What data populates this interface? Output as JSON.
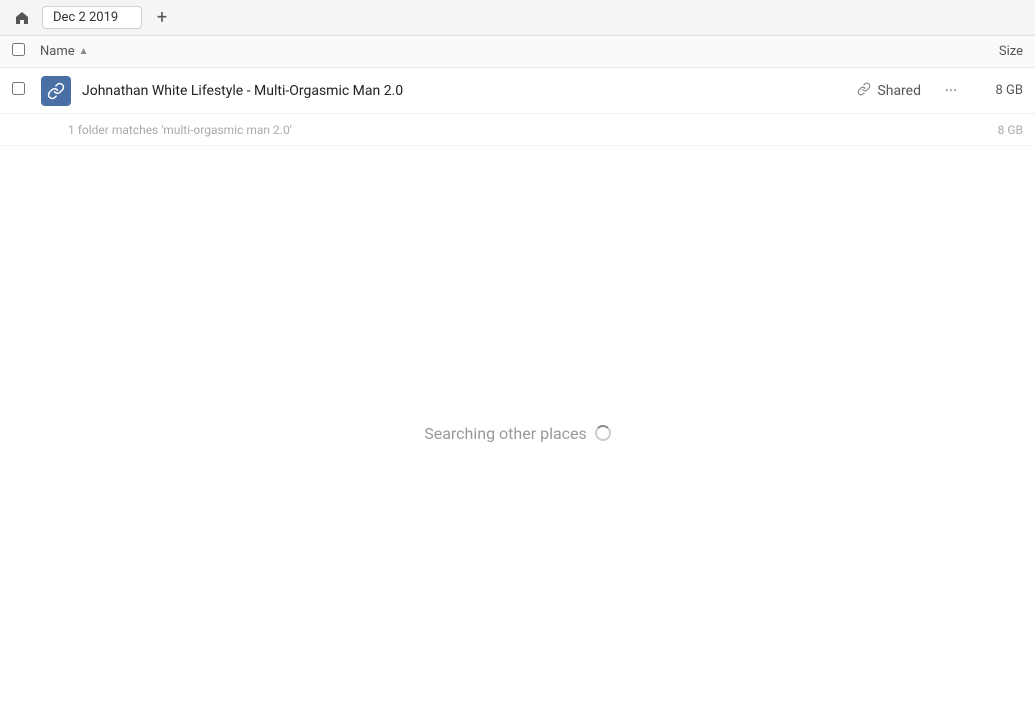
{
  "toolbar": {
    "home_icon": "🏠",
    "breadcrumb_label": "Dec 2 2019",
    "add_icon": "+"
  },
  "column_header": {
    "name_label": "Name",
    "sort_icon": "▲",
    "size_label": "Size"
  },
  "file_row": {
    "file_name": "Johnathan White Lifestyle - Multi-Orgasmic Man 2.0",
    "shared_icon": "🔗",
    "shared_label": "Shared",
    "more_icon": "···",
    "file_size": "8 GB"
  },
  "summary_row": {
    "text": "1 folder matches 'multi-orgasmic man 2.0'",
    "size": "8 GB"
  },
  "content_area": {
    "searching_text": "Searching other places"
  }
}
